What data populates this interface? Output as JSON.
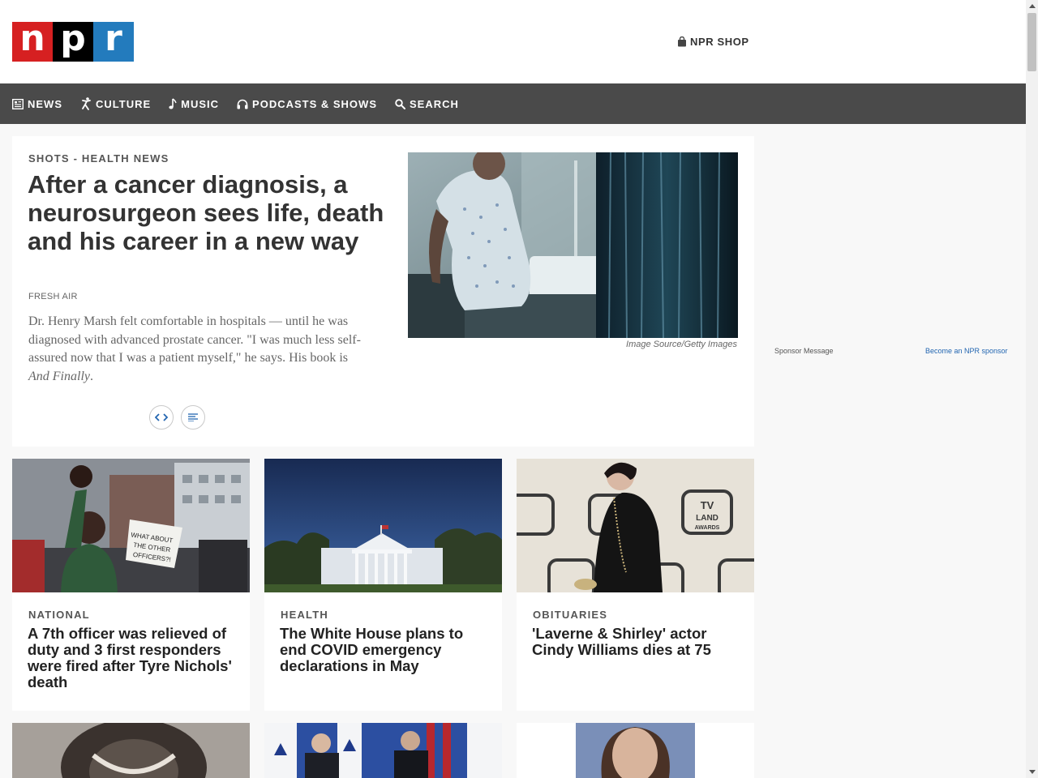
{
  "header": {
    "logo": {
      "letters": [
        "n",
        "p",
        "r"
      ],
      "colors": [
        "#d62021",
        "#000000",
        "#237bbd"
      ]
    },
    "shop_label": "NPR SHOP"
  },
  "nav": {
    "items": [
      {
        "label": "NEWS",
        "icon": "news-icon"
      },
      {
        "label": "CULTURE",
        "icon": "culture-icon"
      },
      {
        "label": "MUSIC",
        "icon": "music-note-icon"
      },
      {
        "label": "PODCASTS & SHOWS",
        "icon": "headphones-icon"
      },
      {
        "label": "SEARCH",
        "icon": "search-icon"
      }
    ]
  },
  "featured": {
    "slug": "SHOTS - HEALTH NEWS",
    "title": "After a cancer diagnosis, a neurosurgeon sees life, death and his career in a new way",
    "show": "FRESH AIR",
    "teaser_main": "Dr. Henry Marsh felt comfortable in hospitals — until he was diagnosed with advanced prostate cancer. \"I was much less self-assured now that I was a patient myself,\" he says. His book is ",
    "teaser_book": "And Finally",
    "teaser_end": ".",
    "image_credit": "Image Source/Getty Images"
  },
  "cards": [
    {
      "slug": "NATIONAL",
      "title": "A 7th officer was relieved of duty and 3 first responders were fired after Tyre Nichols' death"
    },
    {
      "slug": "HEALTH",
      "title": "The White House plans to end COVID emergency declarations in May"
    },
    {
      "slug": "OBITUARIES",
      "title": "'Laverne & Shirley' actor Cindy Williams dies at 75"
    }
  ],
  "photo_text": {
    "protest_sign": [
      "WHAT ABOUT",
      "THE OTHER",
      "OFFICERS?!"
    ],
    "tv_land": [
      "TV",
      "LAND",
      "AWARDS"
    ]
  },
  "sponsor": {
    "label": "Sponsor Message",
    "link": "Become an NPR sponsor"
  }
}
